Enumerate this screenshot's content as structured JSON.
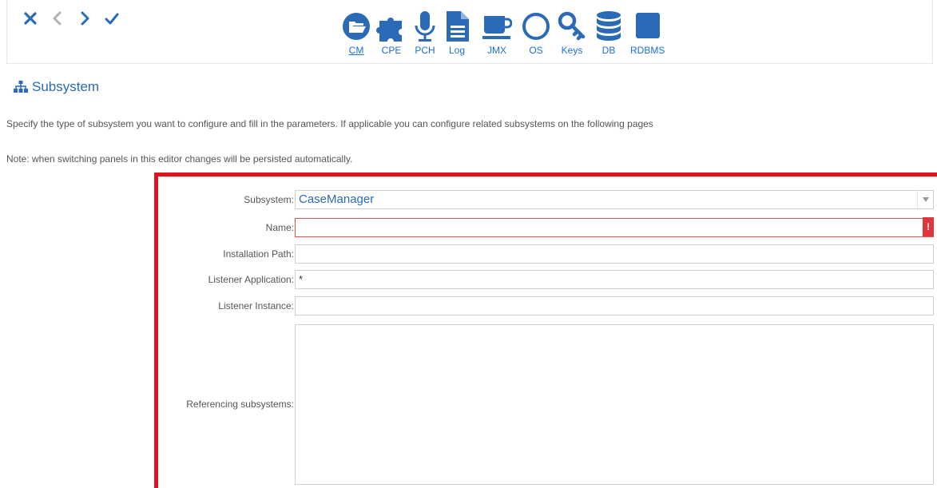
{
  "toolbar": {
    "nav": [
      {
        "name": "close-icon",
        "color": "#2a6ab7"
      },
      {
        "name": "chevron-left-icon",
        "color": "#b3b3b3"
      },
      {
        "name": "chevron-right-icon",
        "color": "#2a6ab7"
      },
      {
        "name": "checkmark-icon",
        "color": "#2a6ab7"
      }
    ],
    "tabs": [
      {
        "label": "CM",
        "icon": "folder-open-icon",
        "active": true
      },
      {
        "label": "CPE",
        "icon": "puzzle-icon"
      },
      {
        "label": "PCH",
        "icon": "microphone-icon"
      },
      {
        "label": "Log",
        "icon": "document-icon"
      },
      {
        "label": "JMX",
        "icon": "coffee-cup-icon"
      },
      {
        "label": "OS",
        "icon": "circle-outline-icon"
      },
      {
        "label": "Keys",
        "icon": "key-icon"
      },
      {
        "label": "DB",
        "icon": "database-icon"
      },
      {
        "label": "RDBMS",
        "icon": "square-icon"
      }
    ]
  },
  "page": {
    "title": "Subsystem",
    "title_icon": "sitemap-icon",
    "description": "Specify the type of subsystem you want to configure and fill in the parameters. If applicable you can configure related subsystems on the following pages",
    "note": "Note: when switching panels in this editor changes will be persisted automatically."
  },
  "form": {
    "subsystem_label": "Subsystem:",
    "subsystem_value": "CaseManager",
    "name_label": "Name:",
    "name_value": "",
    "name_error_icon": "!",
    "install_path_label": "Installation Path:",
    "install_path_value": "",
    "listener_app_label": "Listener Application:",
    "listener_app_value": "*",
    "listener_instance_label": "Listener Instance:",
    "listener_instance_value": "",
    "referencing_label": "Referencing subsystems:",
    "referencing_value": ""
  },
  "colors": {
    "accent": "#2a6ab7",
    "highlight_border": "#e0141e",
    "error": "#e0353b"
  }
}
